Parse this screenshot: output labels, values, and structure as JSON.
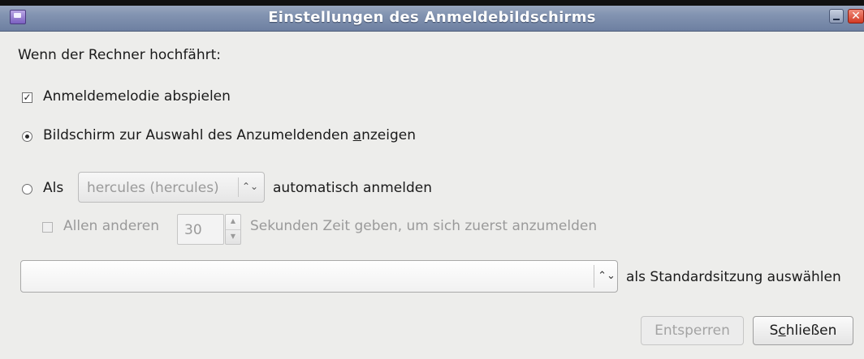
{
  "window": {
    "title": "Einstellungen des Anmeldebildschirms"
  },
  "heading": "Wenn der Rechner hochfährt:",
  "options": {
    "melody": {
      "label": "Anmeldemelodie abspielen",
      "checked": true
    },
    "chooser": {
      "label_pre": "Bildschirm zur Auswahl des Anzumeldenden ",
      "mnemonic": "a",
      "label_post": "nzeigen",
      "selected": true
    },
    "autologin": {
      "label_pre": "Als",
      "user_value": "hercules (hercules)",
      "label_post": "automatisch anmelden",
      "selected": false
    },
    "timed": {
      "label_pre": "Allen anderen",
      "seconds": "30",
      "label_post": "Sekunden Zeit geben, um sich zuerst anzumelden",
      "checked": false,
      "enabled": false
    }
  },
  "session": {
    "value": "",
    "label": "als Standardsitzung auswählen"
  },
  "buttons": {
    "unlock": {
      "label": "Entsperren",
      "enabled": false
    },
    "close": {
      "label_pre": "S",
      "mnemonic": "c",
      "label_post": "hließen"
    }
  },
  "colors": {
    "titlebar": "#8495b2",
    "background": "#ededeb",
    "close_button": "#d23a24"
  }
}
